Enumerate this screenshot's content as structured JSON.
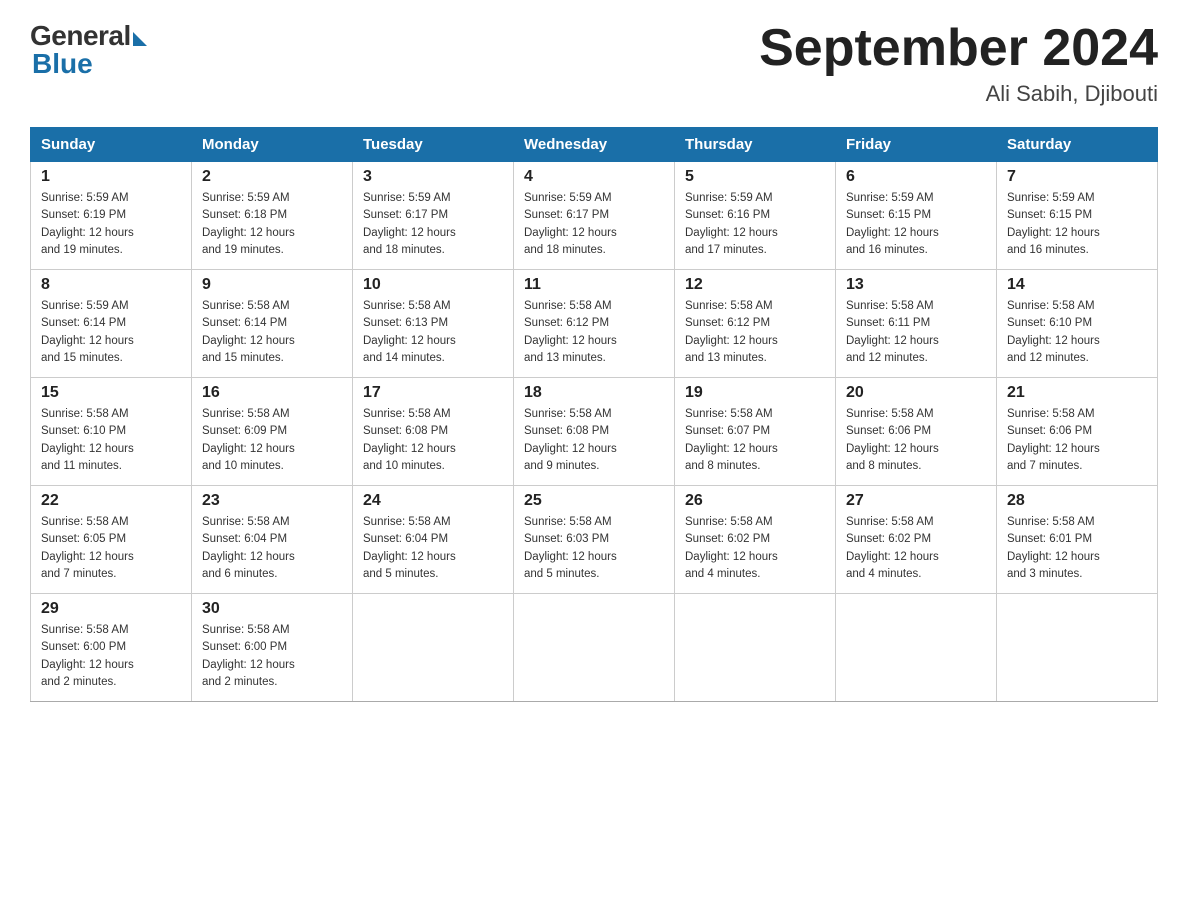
{
  "header": {
    "logo_general": "General",
    "logo_blue": "Blue",
    "title": "September 2024",
    "subtitle": "Ali Sabih, Djibouti"
  },
  "days_of_week": [
    "Sunday",
    "Monday",
    "Tuesday",
    "Wednesday",
    "Thursday",
    "Friday",
    "Saturday"
  ],
  "weeks": [
    [
      {
        "day": "1",
        "sunrise": "5:59 AM",
        "sunset": "6:19 PM",
        "daylight": "12 hours and 19 minutes."
      },
      {
        "day": "2",
        "sunrise": "5:59 AM",
        "sunset": "6:18 PM",
        "daylight": "12 hours and 19 minutes."
      },
      {
        "day": "3",
        "sunrise": "5:59 AM",
        "sunset": "6:17 PM",
        "daylight": "12 hours and 18 minutes."
      },
      {
        "day": "4",
        "sunrise": "5:59 AM",
        "sunset": "6:17 PM",
        "daylight": "12 hours and 18 minutes."
      },
      {
        "day": "5",
        "sunrise": "5:59 AM",
        "sunset": "6:16 PM",
        "daylight": "12 hours and 17 minutes."
      },
      {
        "day": "6",
        "sunrise": "5:59 AM",
        "sunset": "6:15 PM",
        "daylight": "12 hours and 16 minutes."
      },
      {
        "day": "7",
        "sunrise": "5:59 AM",
        "sunset": "6:15 PM",
        "daylight": "12 hours and 16 minutes."
      }
    ],
    [
      {
        "day": "8",
        "sunrise": "5:59 AM",
        "sunset": "6:14 PM",
        "daylight": "12 hours and 15 minutes."
      },
      {
        "day": "9",
        "sunrise": "5:58 AM",
        "sunset": "6:14 PM",
        "daylight": "12 hours and 15 minutes."
      },
      {
        "day": "10",
        "sunrise": "5:58 AM",
        "sunset": "6:13 PM",
        "daylight": "12 hours and 14 minutes."
      },
      {
        "day": "11",
        "sunrise": "5:58 AM",
        "sunset": "6:12 PM",
        "daylight": "12 hours and 13 minutes."
      },
      {
        "day": "12",
        "sunrise": "5:58 AM",
        "sunset": "6:12 PM",
        "daylight": "12 hours and 13 minutes."
      },
      {
        "day": "13",
        "sunrise": "5:58 AM",
        "sunset": "6:11 PM",
        "daylight": "12 hours and 12 minutes."
      },
      {
        "day": "14",
        "sunrise": "5:58 AM",
        "sunset": "6:10 PM",
        "daylight": "12 hours and 12 minutes."
      }
    ],
    [
      {
        "day": "15",
        "sunrise": "5:58 AM",
        "sunset": "6:10 PM",
        "daylight": "12 hours and 11 minutes."
      },
      {
        "day": "16",
        "sunrise": "5:58 AM",
        "sunset": "6:09 PM",
        "daylight": "12 hours and 10 minutes."
      },
      {
        "day": "17",
        "sunrise": "5:58 AM",
        "sunset": "6:08 PM",
        "daylight": "12 hours and 10 minutes."
      },
      {
        "day": "18",
        "sunrise": "5:58 AM",
        "sunset": "6:08 PM",
        "daylight": "12 hours and 9 minutes."
      },
      {
        "day": "19",
        "sunrise": "5:58 AM",
        "sunset": "6:07 PM",
        "daylight": "12 hours and 8 minutes."
      },
      {
        "day": "20",
        "sunrise": "5:58 AM",
        "sunset": "6:06 PM",
        "daylight": "12 hours and 8 minutes."
      },
      {
        "day": "21",
        "sunrise": "5:58 AM",
        "sunset": "6:06 PM",
        "daylight": "12 hours and 7 minutes."
      }
    ],
    [
      {
        "day": "22",
        "sunrise": "5:58 AM",
        "sunset": "6:05 PM",
        "daylight": "12 hours and 7 minutes."
      },
      {
        "day": "23",
        "sunrise": "5:58 AM",
        "sunset": "6:04 PM",
        "daylight": "12 hours and 6 minutes."
      },
      {
        "day": "24",
        "sunrise": "5:58 AM",
        "sunset": "6:04 PM",
        "daylight": "12 hours and 5 minutes."
      },
      {
        "day": "25",
        "sunrise": "5:58 AM",
        "sunset": "6:03 PM",
        "daylight": "12 hours and 5 minutes."
      },
      {
        "day": "26",
        "sunrise": "5:58 AM",
        "sunset": "6:02 PM",
        "daylight": "12 hours and 4 minutes."
      },
      {
        "day": "27",
        "sunrise": "5:58 AM",
        "sunset": "6:02 PM",
        "daylight": "12 hours and 4 minutes."
      },
      {
        "day": "28",
        "sunrise": "5:58 AM",
        "sunset": "6:01 PM",
        "daylight": "12 hours and 3 minutes."
      }
    ],
    [
      {
        "day": "29",
        "sunrise": "5:58 AM",
        "sunset": "6:00 PM",
        "daylight": "12 hours and 2 minutes."
      },
      {
        "day": "30",
        "sunrise": "5:58 AM",
        "sunset": "6:00 PM",
        "daylight": "12 hours and 2 minutes."
      },
      null,
      null,
      null,
      null,
      null
    ]
  ],
  "labels": {
    "sunrise": "Sunrise:",
    "sunset": "Sunset:",
    "daylight": "Daylight:"
  }
}
